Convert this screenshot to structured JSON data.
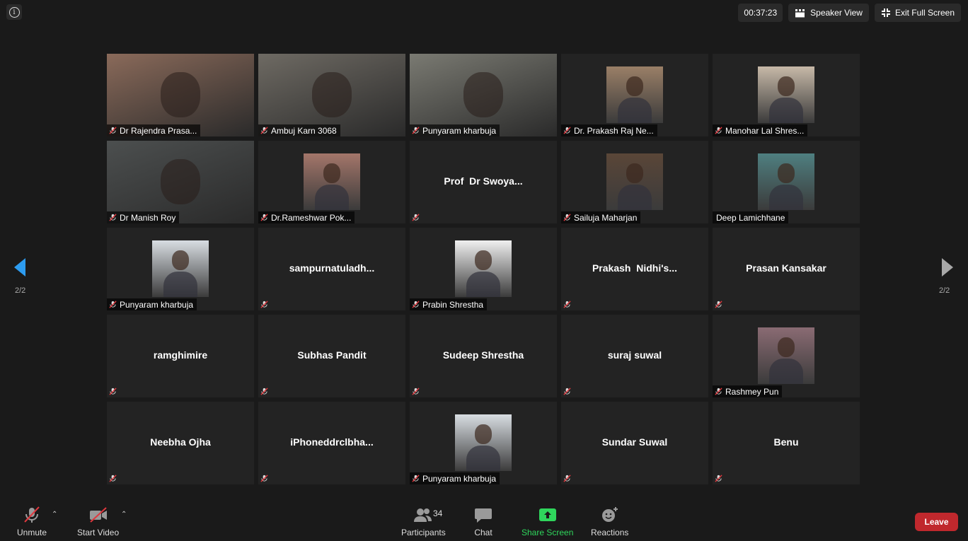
{
  "topbar": {
    "timer": "00:37:23",
    "speaker_view": "Speaker View",
    "exit_full_screen": "Exit Full Screen"
  },
  "pager": {
    "left": "2/2",
    "right": "2/2"
  },
  "tiles": [
    {
      "name": "Dr Rajendra Prasa...",
      "kind": "video",
      "bg": "#8a6a5a"
    },
    {
      "name": "Ambuj Karn 3068",
      "kind": "video",
      "bg": "#6e6a63"
    },
    {
      "name": "Punyaram kharbuja",
      "kind": "video",
      "bg": "#7a7a72"
    },
    {
      "name": "Dr. Prakash Raj Ne...",
      "kind": "photo",
      "bg": "#9a7f67"
    },
    {
      "name": "Manohar Lal Shres...",
      "kind": "photo",
      "bg": "#c7b9a8"
    },
    {
      "name": "Dr Manish Roy",
      "kind": "video",
      "bg": "#4c4f4f"
    },
    {
      "name": "Dr.Rameshwar Pok...",
      "kind": "photo",
      "bg": "#a4766a"
    },
    {
      "display": "Prof  Dr Swoya...",
      "kind": "text"
    },
    {
      "name": "Sailuja Maharjan",
      "kind": "photo",
      "bg": "#5a4638"
    },
    {
      "name": "Deep Lamichhane",
      "kind": "photo",
      "bg": "#4f7f80",
      "nomic": true
    },
    {
      "name": "Punyaram kharbuja",
      "kind": "photo",
      "bg": "#d8dde2"
    },
    {
      "display": "sampurnatuladh...",
      "kind": "text"
    },
    {
      "name": "Prabin Shrestha",
      "kind": "photo",
      "bg": "#f0f0f0"
    },
    {
      "display": "Prakash  Nidhi's...",
      "kind": "text"
    },
    {
      "display": "Prasan Kansakar",
      "kind": "text"
    },
    {
      "display": "ramghimire",
      "kind": "text"
    },
    {
      "display": "Subhas Pandit",
      "kind": "text"
    },
    {
      "display": "Sudeep Shrestha",
      "kind": "text"
    },
    {
      "display": "suraj suwal",
      "kind": "text"
    },
    {
      "name": "Rashmey Pun",
      "kind": "photo",
      "bg": "#8a6b73"
    },
    {
      "display": "Neebha Ojha",
      "kind": "text"
    },
    {
      "display": "iPhoneddrclbha...",
      "kind": "text"
    },
    {
      "name": "Punyaram kharbuja",
      "kind": "photo",
      "bg": "#d8dde2"
    },
    {
      "display": "Sundar Suwal",
      "kind": "text"
    },
    {
      "display": "Benu",
      "kind": "text"
    }
  ],
  "toolbar": {
    "unmute": "Unmute",
    "start_video": "Start Video",
    "participants": "Participants",
    "participants_count": "34",
    "chat": "Chat",
    "share_screen": "Share Screen",
    "reactions": "Reactions",
    "leave": "Leave"
  },
  "colors": {
    "share_green": "#2fd65c",
    "leave_red": "#c0282d",
    "mute_red": "#e0383e"
  }
}
